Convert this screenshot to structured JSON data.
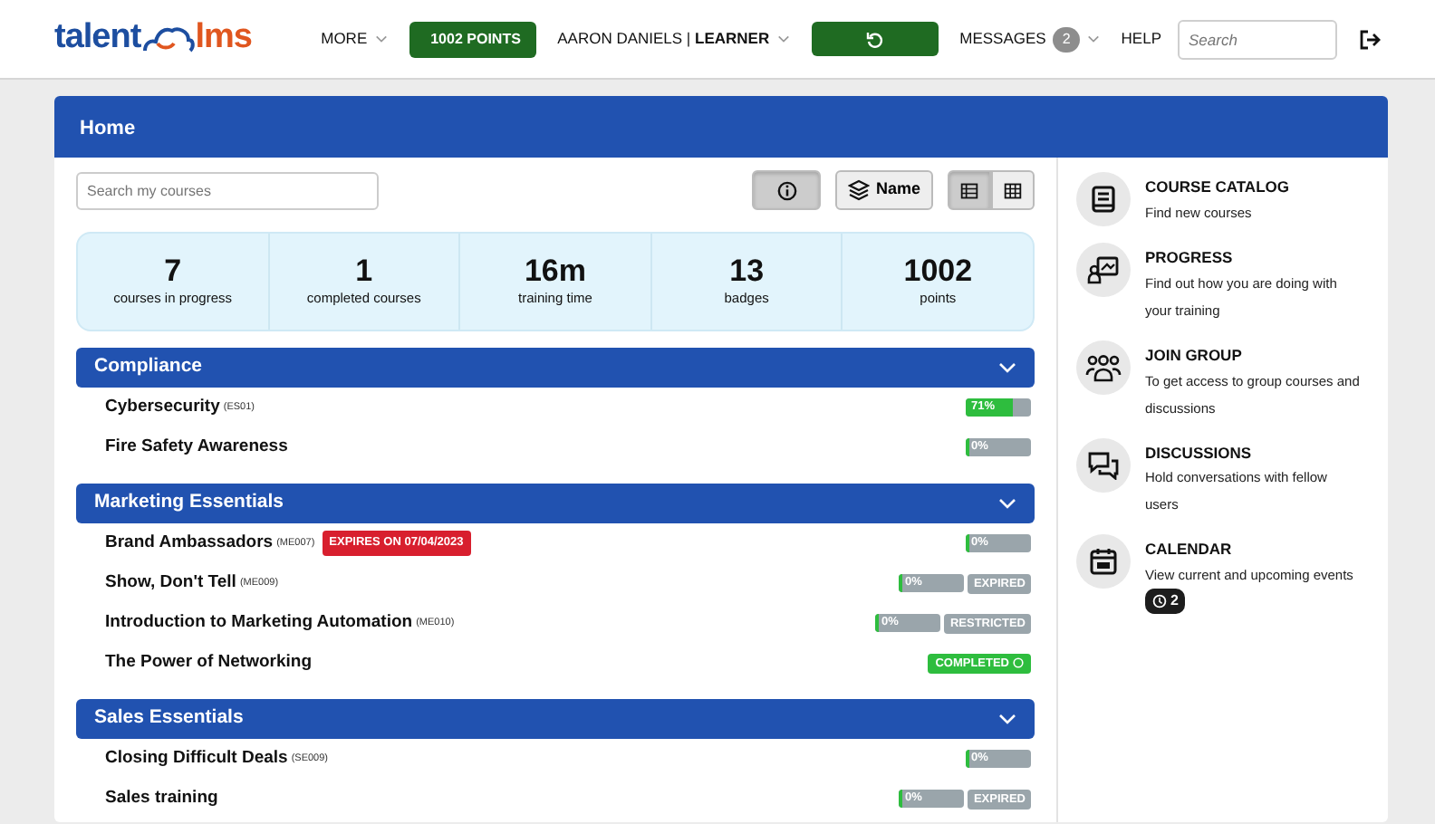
{
  "logo": {
    "left": "talent",
    "right": "lms"
  },
  "nav": {
    "more": "MORE",
    "points": "1002 POINTS",
    "user_name": "AARON DANIELS",
    "user_separator": "|",
    "user_role": "LEARNER",
    "messages": "MESSAGES",
    "messages_count": "2",
    "help": "HELP",
    "search_placeholder": "Search"
  },
  "page": {
    "title": "Home",
    "search_placeholder": "Search my courses",
    "sort_label": "Name",
    "views": [
      {
        "kind": "list",
        "selected": true
      },
      {
        "kind": "grid",
        "selected": false
      }
    ]
  },
  "stats": [
    {
      "value": "7",
      "label": "courses in progress"
    },
    {
      "value": "1",
      "label": "completed courses"
    },
    {
      "value": "16m",
      "label": "training time"
    },
    {
      "value": "13",
      "label": "badges"
    },
    {
      "value": "1002",
      "label": "points"
    }
  ],
  "categories": [
    {
      "name": "Compliance",
      "expanded": true,
      "courses": [
        {
          "name": "Cybersecurity",
          "code": "(ES01)",
          "kind": "progress",
          "level": 0.71,
          "reading": "71%"
        },
        {
          "name": "Fire Safety Awareness",
          "kind": "progress",
          "level": 0,
          "reading": "0%"
        }
      ]
    },
    {
      "name": "Marketing Essentials",
      "expanded": true,
      "courses": [
        {
          "name": "Brand Ambassadors",
          "code": "(ME007)",
          "expiry": "EXPIRES ON 07/04/2023",
          "kind": "progress",
          "level": 0,
          "reading": "0%"
        },
        {
          "name": "Show, Don't Tell",
          "code": "(ME009)",
          "kind": "progress",
          "level": 0,
          "reading": "0%",
          "tag": "EXPIRED"
        },
        {
          "name": "Introduction to Marketing Automation",
          "code": "(ME010)",
          "kind": "progress",
          "level": 0,
          "reading": "0%",
          "tag": "RESTRICTED"
        },
        {
          "name": "The Power of Networking",
          "kind": "completed",
          "reading": "COMPLETED"
        }
      ]
    },
    {
      "name": "Sales Essentials",
      "expanded": true,
      "courses": [
        {
          "name": "Closing Difficult Deals",
          "code": "(SE009)",
          "kind": "progress",
          "level": 0,
          "reading": "0%"
        },
        {
          "name": "Sales training",
          "kind": "progress",
          "level": 0,
          "reading": "0%",
          "tag": "EXPIRED"
        }
      ]
    }
  ],
  "sidebar": [
    {
      "kind": "catalog",
      "title": "COURSE CATALOG",
      "text": "Find new courses"
    },
    {
      "kind": "progress",
      "title": "PROGRESS",
      "text": "Find out how you are doing with your training"
    },
    {
      "kind": "group",
      "title": "JOIN GROUP",
      "text": "To get access to group courses and discussions"
    },
    {
      "kind": "discussions",
      "title": "DISCUSSIONS",
      "text": "Hold conversations with fellow users"
    },
    {
      "kind": "calendar",
      "title": "CALENDAR",
      "text": "View current and upcoming events",
      "count": "2"
    }
  ]
}
